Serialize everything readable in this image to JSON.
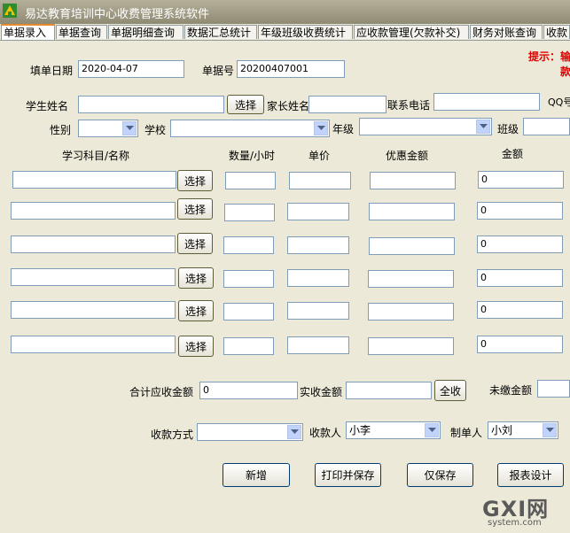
{
  "window": {
    "title": "易达教育培训中心收费管理系统软件"
  },
  "tabs": [
    {
      "label": "单据录入",
      "active": true
    },
    {
      "label": "单据查询"
    },
    {
      "label": "单据明细查询"
    },
    {
      "label": "数据汇总统计"
    },
    {
      "label": "年级班级收费统计"
    },
    {
      "label": "应收款管理(欠款补交)"
    },
    {
      "label": "财务对账查询"
    },
    {
      "label": "收款"
    }
  ],
  "header": {
    "date_label": "填单日期",
    "date_value": "2020-04-07",
    "doc_no_label": "单据号",
    "doc_no_value": "20200407001",
    "hint_line1": "提示：输",
    "hint_line2": "款"
  },
  "student": {
    "name_label": "学生姓名",
    "select_label": "选择",
    "parent_label": "家长姓名",
    "phone_label": "联系电话",
    "qq_label": "QQ号",
    "gender_label": "性别",
    "school_label": "学校",
    "grade_label": "年级",
    "class_label": "班级"
  },
  "items": {
    "col_subject": "学习科目/名称",
    "col_qty": "数量/小时",
    "col_price": "单价",
    "col_discount": "优惠金额",
    "col_amount": "金额",
    "select_label": "选择",
    "rows": [
      {
        "amount": "0"
      },
      {
        "amount": "0"
      },
      {
        "amount": "0"
      },
      {
        "amount": "0"
      },
      {
        "amount": "0"
      },
      {
        "amount": "0"
      }
    ]
  },
  "totals": {
    "receivable_label": "合计应收金额",
    "receivable_value": "0",
    "received_label": "实收金额",
    "full_label": "全收",
    "unpaid_label": "未缴金额"
  },
  "payment": {
    "method_label": "收款方式",
    "method_value": "",
    "payee_label": "收款人",
    "payee_value": "小李",
    "maker_label": "制单人",
    "maker_value": "小刘"
  },
  "actions": {
    "new_label": "新增",
    "print_save_label": "打印并保存",
    "save_only_label": "仅保存",
    "report_label": "报表设计"
  },
  "watermark": {
    "main": "GXI网",
    "sub": "system.com"
  },
  "colors": {
    "hint": "#E00000",
    "tab_accent": "#E68B2C",
    "window_bg": "#ECE9D8"
  }
}
